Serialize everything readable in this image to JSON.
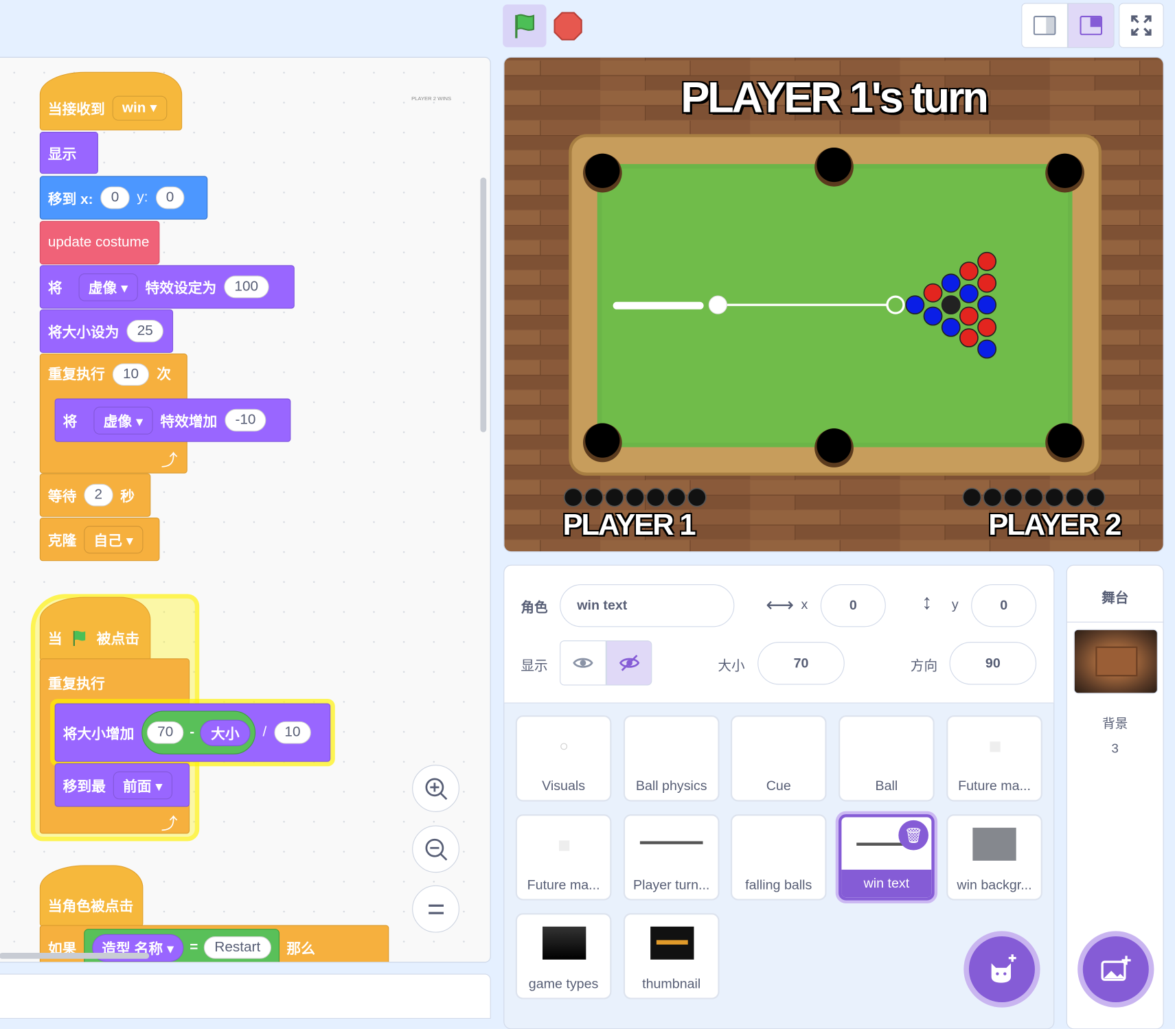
{
  "toolbar": {
    "green_flag": "green-flag-icon",
    "stop": "stop-icon"
  },
  "colors": {
    "accent": "#855cd6",
    "events": "#f6b83c",
    "looks": "#9966ff",
    "motion": "#4c97ff",
    "control": "#f6b03e",
    "myblocks": "#f06278",
    "operators": "#59c059"
  },
  "code": {
    "thumb_text": "PLAYER 2 WINS",
    "script1": {
      "hat": "当接收到",
      "hat_msg": "win",
      "show": "显示",
      "goto": "移到 x:",
      "goto_x": "0",
      "goto_y_label": "y:",
      "goto_y": "0",
      "custom": "update costume",
      "set_effect_a": "将",
      "set_effect_menu": "虚像",
      "set_effect_b": "特效设定为",
      "set_effect_val": "100",
      "set_size": "将大小设为",
      "set_size_val": "25",
      "repeat": "重复执行",
      "repeat_n": "10",
      "repeat_times": "次",
      "change_effect_a": "将",
      "change_effect_menu": "虚像",
      "change_effect_b": "特效增加",
      "change_effect_val": "-10",
      "wait": "等待",
      "wait_n": "2",
      "wait_unit": "秒",
      "clone": "克隆",
      "clone_menu": "自己"
    },
    "script2": {
      "hat_a": "当",
      "hat_b": "被点击",
      "forever": "重复执行",
      "change_size": "将大小增加",
      "op_a": "70",
      "op_minus": "-",
      "op_size": "大小",
      "op_div": "/",
      "op_b": "10",
      "go_to_front": "移到最",
      "front_menu": "前面"
    },
    "script3": {
      "hat": "当角色被点击",
      "if": "如果",
      "costume": "造型",
      "costume_menu": "名称",
      "eq": "=",
      "value": "Restart",
      "then": "那么"
    }
  },
  "stage": {
    "title": "PLAYER 1's turn",
    "player1": "PLAYER 1",
    "player2": "PLAYER 2"
  },
  "sprite_info": {
    "sprite_label": "角色",
    "sprite_name": "win text",
    "x_label": "x",
    "x": "0",
    "y_label": "y",
    "y": "0",
    "show_label": "显示",
    "size_label": "大小",
    "size": "70",
    "direction_label": "方向",
    "direction": "90",
    "visible": false
  },
  "sprites": [
    {
      "name": "Visuals"
    },
    {
      "name": "Ball physics"
    },
    {
      "name": "Cue"
    },
    {
      "name": "Ball"
    },
    {
      "name": "Future ma..."
    },
    {
      "name": "Future ma..."
    },
    {
      "name": "Player turn..."
    },
    {
      "name": "falling balls"
    },
    {
      "name": "win text",
      "selected": true
    },
    {
      "name": "win backgr..."
    },
    {
      "name": "game types"
    },
    {
      "name": "thumbnail"
    }
  ],
  "stage_panel": {
    "title": "舞台",
    "backdrop_label": "背景",
    "backdrop_count": "3"
  }
}
